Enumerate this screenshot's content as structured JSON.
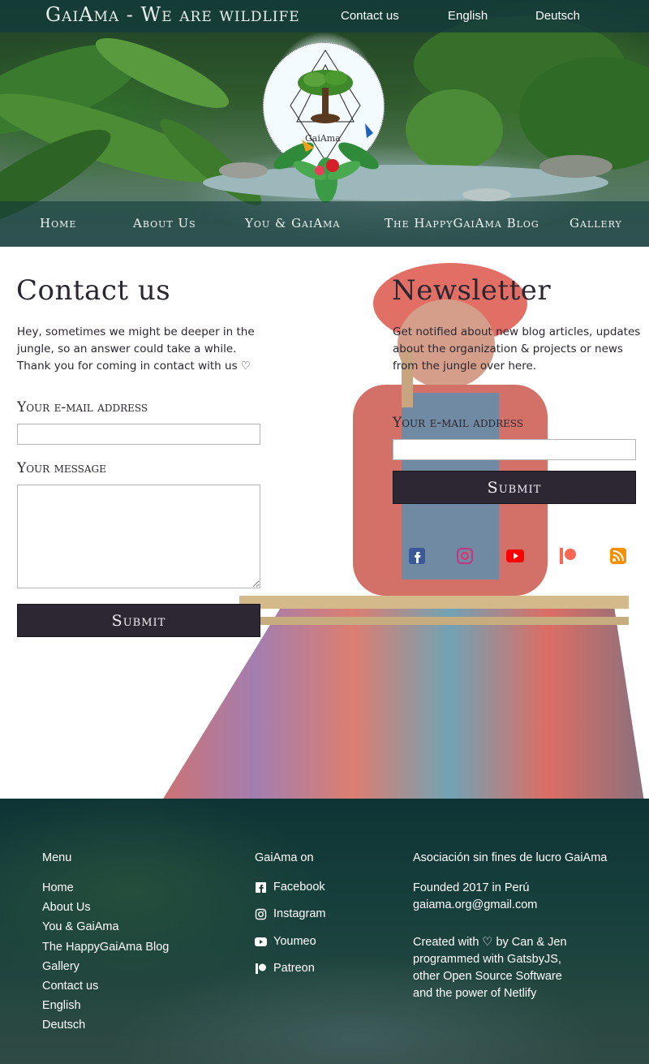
{
  "header": {
    "brand": "GaiAma - We are wildlife",
    "top_links": [
      "Contact us",
      "English",
      "Deutsch"
    ],
    "logo_text": "GaiAma"
  },
  "nav": {
    "items": [
      "Home",
      "About Us",
      "You & GaiAma",
      "The HappyGaiAma Blog",
      "Gallery"
    ]
  },
  "contact": {
    "title": "Contact us",
    "intro_lines": [
      "Hey, sometimes we might be deeper in the",
      "jungle, so an answer could take a while.",
      "Thank you for coming in contact with us ♡"
    ],
    "email_label": "Your e-mail address",
    "email_value": "",
    "message_label": "Your message",
    "message_value": "",
    "submit_label": "Submit"
  },
  "newsletter": {
    "title": "Newsletter",
    "intro_lines": [
      "Get notified about new blog articles, updates",
      "about the organization & projects or news",
      "from the jungle over here."
    ],
    "email_label": "Your e-mail address",
    "email_value": "",
    "submit_label": "Submit",
    "social_icons": [
      "facebook-icon",
      "instagram-icon",
      "youtube-icon",
      "patreon-icon",
      "rss-icon"
    ]
  },
  "footer": {
    "menu_heading": "Menu",
    "menu_items": [
      "Home",
      "About Us",
      "You & GaiAma",
      "The HappyGaiAma Blog",
      "Gallery",
      "Contact us",
      "English",
      "Deutsch"
    ],
    "social_heading": "GaiAma on",
    "social_items": [
      "Facebook",
      "Instagram",
      "Youmeo",
      "Patreon"
    ],
    "org_heading": "Asociación sin fines de lucro GaiAma",
    "org_lines": [
      "Founded 2017 in Perú",
      "gaiama.org@gmail.com"
    ],
    "credits_lines": [
      "Created with ♡ by Can & Jen",
      "programmed with GatsbyJS,",
      "other Open Source Software",
      "and the power of Netlify"
    ]
  },
  "colors": {
    "header_bar": "#143a3a",
    "button_bg": "#2d2733",
    "text": "#2b2630",
    "facebook": "#3b5998",
    "instagram": "#c13584",
    "youtube": "#ff0000",
    "patreon": "#f96854",
    "rss": "#f99000"
  }
}
